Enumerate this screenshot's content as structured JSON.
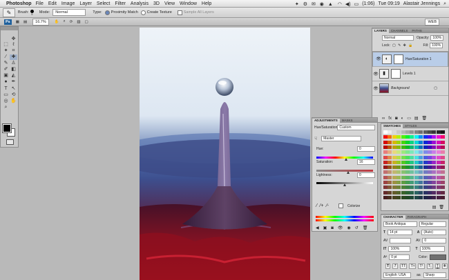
{
  "menubar": {
    "app_name": "Photoshop",
    "items": [
      "File",
      "Edit",
      "Image",
      "Layer",
      "Select",
      "Filter",
      "Analysis",
      "3D",
      "View",
      "Window",
      "Help"
    ],
    "battery": "(1:06)",
    "clock": "Tue 09:19",
    "user": "Alastair Jennings"
  },
  "options": {
    "brush_label": "Brush:",
    "brush_size": "5",
    "mode_label": "Mode:",
    "mode_value": "Normal",
    "type_label": "Type:",
    "proximity": "Proximity Match",
    "create_texture": "Create Texture",
    "sample_all": "Sample All Layers"
  },
  "appbar": {
    "ps_badge": "Ps",
    "zoom": "16.7",
    "workspace": "WEB"
  },
  "layers_panel": {
    "tabs": [
      "LAYERS",
      "CHANNELS",
      "PATHS"
    ],
    "blend": "Normal",
    "opacity_label": "Opacity:",
    "opacity": "100%",
    "lock_label": "Lock:",
    "fill_label": "Fill:",
    "fill": "100%",
    "layers": [
      {
        "name": "Hue/Saturation 1"
      },
      {
        "name": "Levels 1"
      },
      {
        "name": "Background"
      }
    ]
  },
  "adjustments_panel": {
    "tabs": [
      "ADJUSTMENTS",
      "MASKS"
    ],
    "title": "Hue/Saturation",
    "preset": "Custom",
    "channel": "Master",
    "hue_label": "Hue:",
    "hue": "0",
    "saturation_label": "Saturation:",
    "saturation": "16",
    "lightness_label": "Lightness:",
    "lightness": "0",
    "colorize": "Colorize",
    "levels": {
      "hue": 0.52,
      "saturation": 0.56,
      "lightness": 0.5
    }
  },
  "swatches_panel": {
    "tabs": [
      "SWATCHES",
      "STYLES"
    ]
  },
  "character_panel": {
    "tabs": [
      "CHARACTER",
      "PARAGRAPH"
    ],
    "font": "Book Antiqua",
    "style": "Regular",
    "size": "14 pt",
    "leading": "(Auto)",
    "tracking": "0",
    "vscale": "100%",
    "hscale": "100%",
    "baseline": "0 pt",
    "color_label": "Color:",
    "language": "English: USA",
    "aa": "Sharp",
    "aa_prefix": "aa"
  }
}
